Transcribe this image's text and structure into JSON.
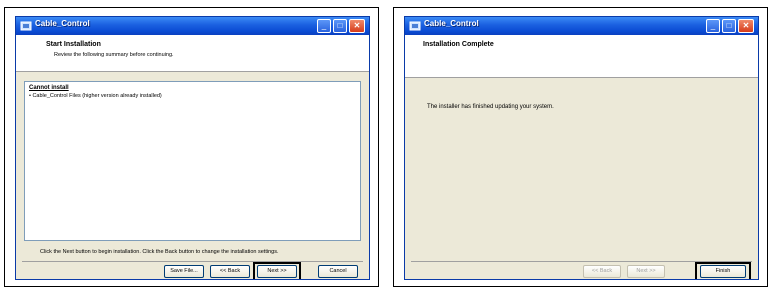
{
  "left_window": {
    "title": "Cable_Control",
    "header_title": "Start Installation",
    "header_subtitle": "Review the following summary before continuing.",
    "list_heading": "Cannot install",
    "list_items": [
      "• Cable_Control Files (higher version already installed)"
    ],
    "note": "Click the Next button to begin installation.  Click the Back button to change the installation settings.",
    "buttons": {
      "save": "Save File...",
      "back": "<< Back",
      "next": "Next >>",
      "cancel": "Cancel"
    }
  },
  "right_window": {
    "title": "Cable_Control",
    "header_title": "Installation Complete",
    "message": "The installer has finished updating your system.",
    "buttons": {
      "back": "<< Back",
      "next": "Next >>",
      "finish": "Finish"
    }
  },
  "colors": {
    "titlebar": "#0a4bd3",
    "dialog_bg": "#ece9d8",
    "close_button": "#d63b1a"
  }
}
